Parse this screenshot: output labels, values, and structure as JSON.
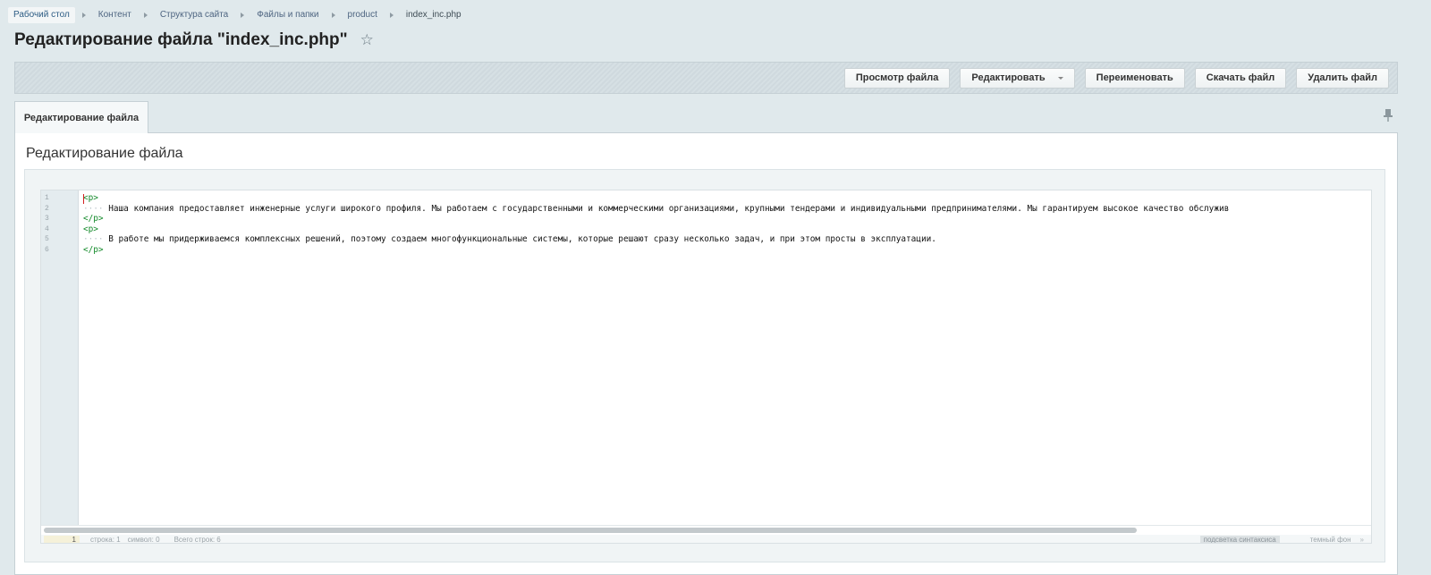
{
  "breadcrumbs": [
    {
      "label": "Рабочий стол"
    },
    {
      "label": "Контент"
    },
    {
      "label": "Структура сайта"
    },
    {
      "label": "Файлы и папки"
    },
    {
      "label": "product"
    },
    {
      "label": "index_inc.php"
    }
  ],
  "page": {
    "title": "Редактирование файла \"index_inc.php\"",
    "star_icon": "☆"
  },
  "toolbar": {
    "view_label": "Просмотр файла",
    "edit_label": "Редактировать",
    "rename_label": "Переименовать",
    "download_label": "Скачать файл",
    "delete_label": "Удалить файл"
  },
  "tabs": {
    "active_label": "Редактирование файла"
  },
  "panel": {
    "heading": "Редактирование файла"
  },
  "editor": {
    "line_numbers": [
      "1",
      "2",
      "3",
      "4",
      "5",
      "6"
    ],
    "lines": [
      {
        "indent": "",
        "tag": "<p>",
        "text": ""
      },
      {
        "indent": "····",
        "tag": "",
        "text": "Наша компания предоставляет инженерные услуги широкого профиля. Мы работаем с государственными и коммерческими организациями, крупными тендерами и индивидуальными предпринимателями. Мы гарантируем высокое качество обслужив"
      },
      {
        "indent": "",
        "tag": "</p>",
        "text": ""
      },
      {
        "indent": "",
        "tag": "<p>",
        "text": ""
      },
      {
        "indent": "····",
        "tag": "",
        "text": "В работе мы придерживаемся комплексных решений, поэтому создаем многофункциональные системы, которые решают сразу несколько задач, и при этом просты в эксплуатации."
      },
      {
        "indent": "",
        "tag": "</p>",
        "text": ""
      }
    ]
  },
  "statusbar": {
    "current_line": "1",
    "line_text": "строка: 1",
    "symbol_text": "символ: 0",
    "total_text": "Всего строк: 6",
    "highlight_text": "подсветка синтаксиса",
    "theme_text": "темный фон",
    "dot": "»"
  },
  "colors": {
    "tag": "#138a2a",
    "cursor": "#d21f1f",
    "background": "#e0e9ec"
  }
}
